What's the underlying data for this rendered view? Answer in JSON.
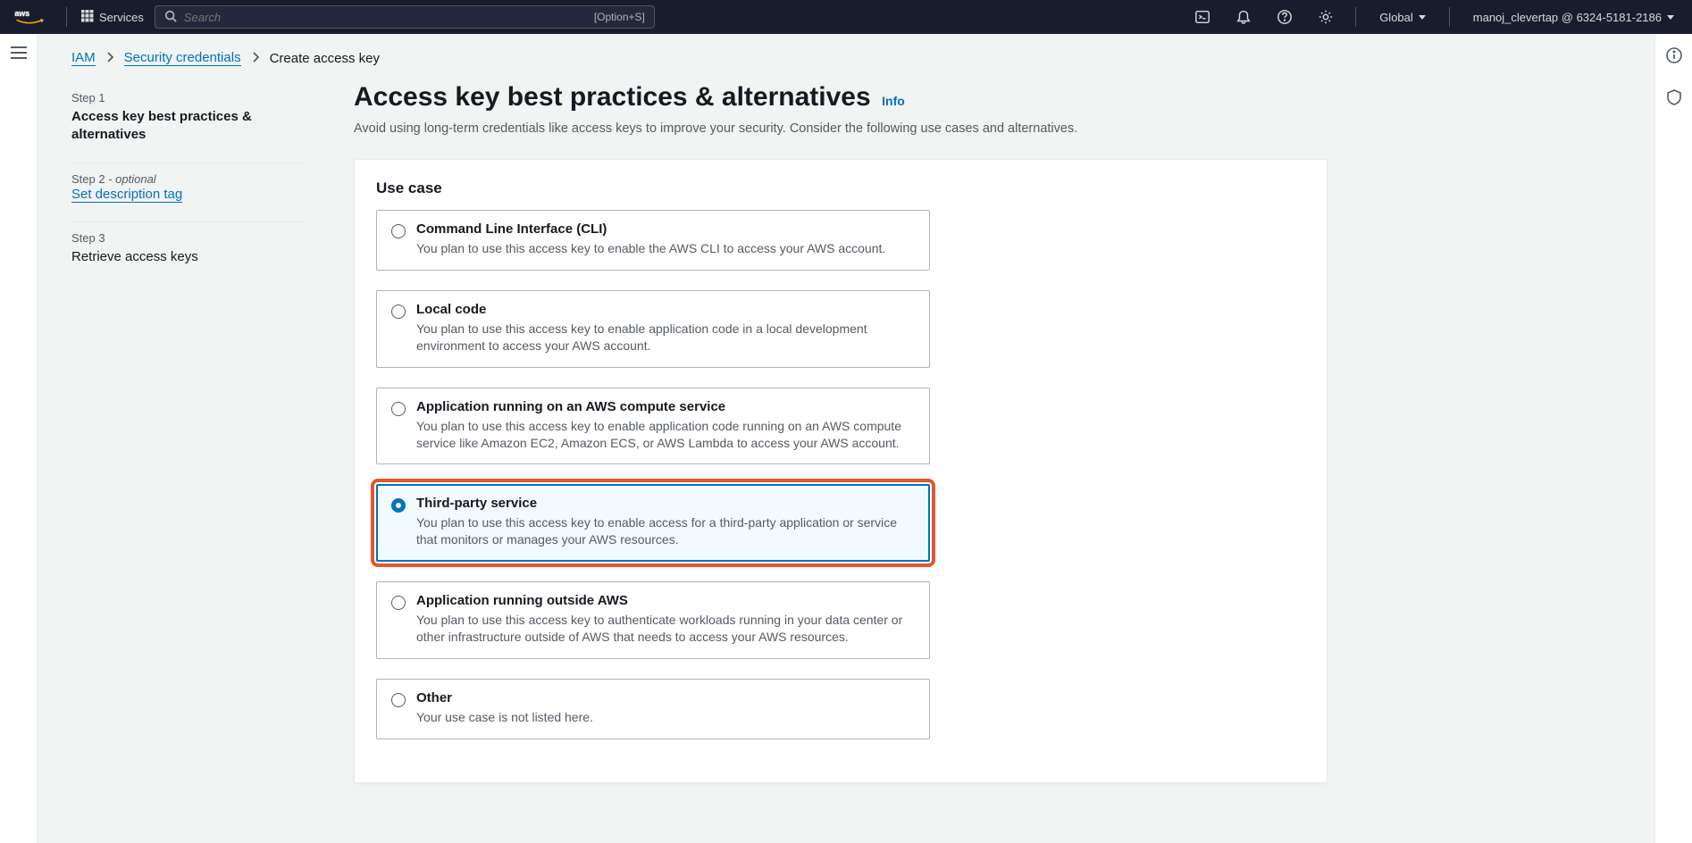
{
  "topnav": {
    "services_label": "Services",
    "search_placeholder": "Search",
    "search_shortcut": "[Option+S]",
    "region": "Global",
    "account": "manoj_clevertap @ 6324-5181-2186"
  },
  "breadcrumbs": {
    "items": [
      "IAM",
      "Security credentials",
      "Create access key"
    ]
  },
  "wizard": {
    "steps": [
      {
        "label": "Step 1",
        "optional": "",
        "title": "Access key best practices & alternatives",
        "active": true,
        "link": false
      },
      {
        "label": "Step 2",
        "optional": " - optional",
        "title": "Set description tag",
        "active": false,
        "link": true
      },
      {
        "label": "Step 3",
        "optional": "",
        "title": "Retrieve access keys",
        "active": false,
        "link": false
      }
    ]
  },
  "panel": {
    "title": "Access key best practices & alternatives",
    "info": "Info",
    "subtitle": "Avoid using long-term credentials like access keys to improve your security. Consider the following use cases and alternatives.",
    "card_header": "Use case",
    "options": [
      {
        "id": "cli",
        "title": "Command Line Interface (CLI)",
        "desc": "You plan to use this access key to enable the AWS CLI to access your AWS account.",
        "selected": false,
        "highlighted": false
      },
      {
        "id": "local-code",
        "title": "Local code",
        "desc": "You plan to use this access key to enable application code in a local development environment to access your AWS account.",
        "selected": false,
        "highlighted": false
      },
      {
        "id": "aws-compute",
        "title": "Application running on an AWS compute service",
        "desc": "You plan to use this access key to enable application code running on an AWS compute service like Amazon EC2, Amazon ECS, or AWS Lambda to access your AWS account.",
        "selected": false,
        "highlighted": false
      },
      {
        "id": "third-party",
        "title": "Third-party service",
        "desc": "You plan to use this access key to enable access for a third-party application or service that monitors or manages your AWS resources.",
        "selected": true,
        "highlighted": true
      },
      {
        "id": "outside-aws",
        "title": "Application running outside AWS",
        "desc": "You plan to use this access key to authenticate workloads running in your data center or other infrastructure outside of AWS that needs to access your AWS resources.",
        "selected": false,
        "highlighted": false
      },
      {
        "id": "other",
        "title": "Other",
        "desc": "Your use case is not listed here.",
        "selected": false,
        "highlighted": false
      }
    ]
  }
}
